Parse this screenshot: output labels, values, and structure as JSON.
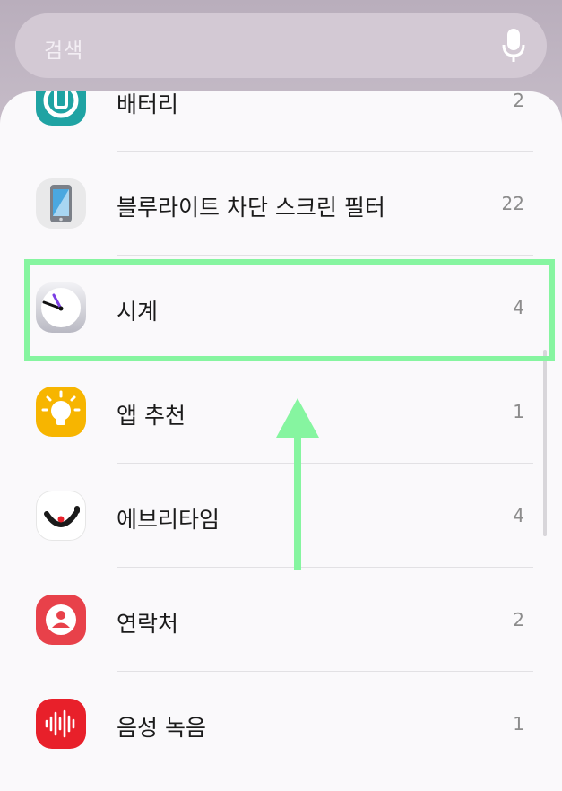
{
  "search": {
    "placeholder": "검색",
    "icon": "microphone-icon"
  },
  "items": [
    {
      "label": "배터리",
      "count": "2",
      "icon": "battery-icon",
      "color": "#1fa3a3"
    },
    {
      "label": "블루라이트 차단 스크린 필터",
      "count": "22",
      "icon": "phone-screen-icon",
      "color": "#e9e9ea"
    },
    {
      "label": "시계",
      "count": "4",
      "icon": "clock-icon",
      "color": "#d9d9df"
    },
    {
      "label": "앱 추천",
      "count": "1",
      "icon": "lightbulb-icon",
      "color": "#f7b500"
    },
    {
      "label": "에브리타임",
      "count": "4",
      "icon": "everytime-icon",
      "color": "#ffffff"
    },
    {
      "label": "연락처",
      "count": "2",
      "icon": "contact-icon",
      "color": "#e8414a"
    },
    {
      "label": "음성 녹음",
      "count": "1",
      "icon": "voice-recorder-icon",
      "color": "#e8202a"
    }
  ],
  "annotation": {
    "highlight_color": "#86f5a0",
    "highlighted_item": "시계"
  }
}
